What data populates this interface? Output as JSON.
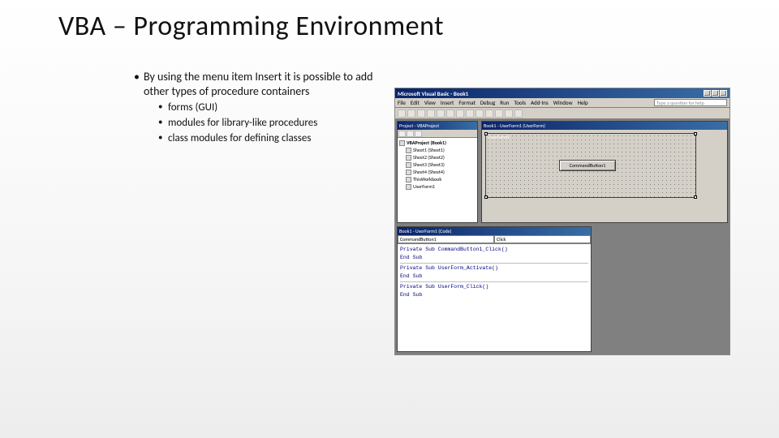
{
  "slide": {
    "title": "VBA – Programming Environment",
    "bullet": "By using the menu item Insert it is possible to add other types of procedure containers",
    "sub_bullets": [
      "forms (GUI)",
      "modules for library-like procedures",
      "class modules for defining classes"
    ]
  },
  "ide": {
    "title": "Microsoft Visual Basic - Book1",
    "menus": [
      "File",
      "Edit",
      "View",
      "Insert",
      "Format",
      "Debug",
      "Run",
      "Tools",
      "Add-Ins",
      "Window",
      "Help"
    ],
    "help_placeholder": "Type a question for help",
    "project_pane": {
      "title": "Project - VBAProject",
      "root": "VBAProject (Book1)",
      "items": [
        "Sheet1 (Sheet1)",
        "Sheet2 (Sheet2)",
        "Sheet3 (Sheet3)",
        "Sheet4 (Sheet4)",
        "ThisWorkbook",
        "UserForm1"
      ]
    },
    "designer": {
      "pane_title": "Book1 - UserForm1 (UserForm)",
      "userform_caption": "UserForm1",
      "button_caption": "CommandButton1"
    },
    "code_window": {
      "pane_title": "Book1 - UserForm1 (Code)",
      "object_combo": "CommandButton1",
      "proc_combo": "Click",
      "lines": [
        {
          "t": "Private Sub CommandButton1_Click()",
          "kw": true
        },
        {
          "t": ""
        },
        {
          "t": "End Sub",
          "kw": true
        },
        {
          "hr": true
        },
        {
          "t": "Private Sub UserForm_Activate()",
          "kw": true
        },
        {
          "t": ""
        },
        {
          "t": "End Sub",
          "kw": true
        },
        {
          "hr": true
        },
        {
          "t": "Private Sub UserForm_Click()",
          "kw": true
        },
        {
          "t": ""
        },
        {
          "t": "End Sub",
          "kw": true
        }
      ]
    }
  }
}
